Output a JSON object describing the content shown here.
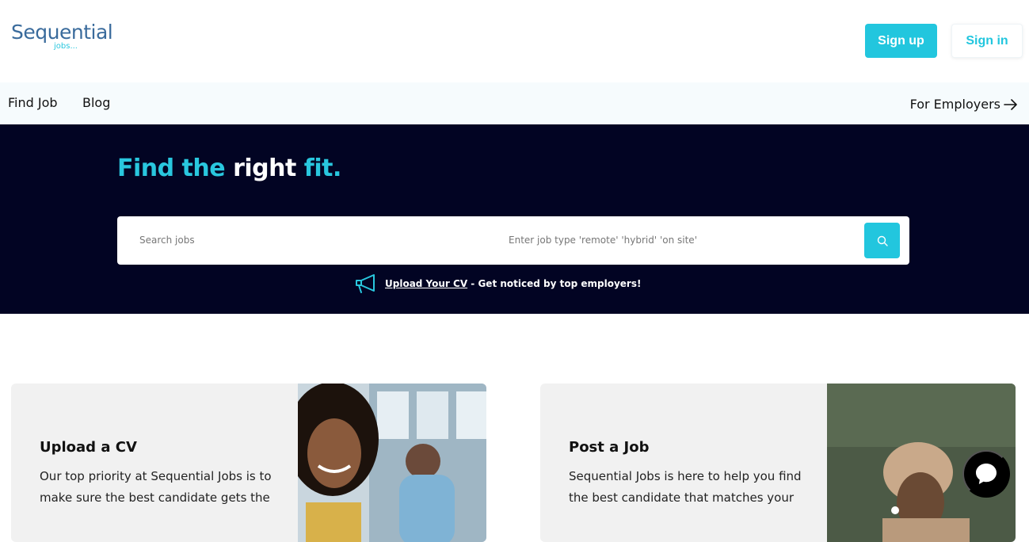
{
  "brand": {
    "name": "Sequential",
    "sub": "jobs..."
  },
  "auth": {
    "signup_label": "Sign up",
    "signin_label": "Sign in"
  },
  "nav": {
    "find_job": "Find Job",
    "blog": "Blog",
    "for_employers": "For Employers"
  },
  "hero": {
    "title_part1": "Find the",
    "title_part2": "right",
    "title_part3": "fit.",
    "search_placeholder": "Search jobs",
    "type_placeholder": "Enter job type 'remote' 'hybrid' 'on site'",
    "upload_link": "Upload Your CV",
    "upload_text": " - Get noticed by top employers!"
  },
  "cards": [
    {
      "title": "Upload a CV",
      "description": "Our top priority at Sequential Jobs is to make sure the best candidate gets the"
    },
    {
      "title": "Post a Job",
      "description": "Sequential Jobs is here to help you find the best candidate that matches your"
    }
  ],
  "colors": {
    "accent": "#22c6de",
    "hero_bg": "#020423",
    "card_bg": "#f1f1f1"
  },
  "icons": [
    "search-icon",
    "megaphone-icon",
    "arrow-right-icon",
    "chat-icon"
  ]
}
